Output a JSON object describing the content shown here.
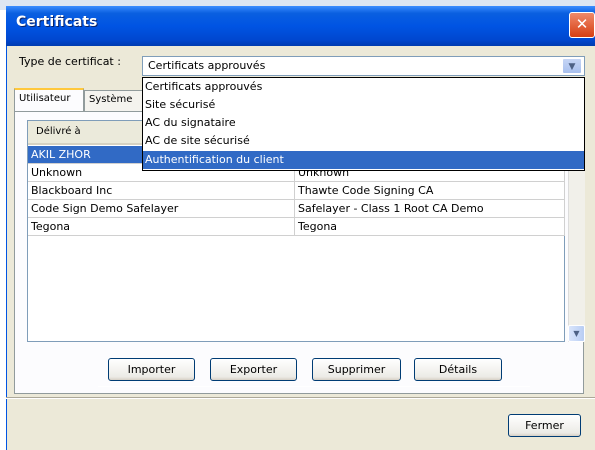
{
  "window": {
    "title": "Certificats",
    "close_glyph": "✕"
  },
  "type_selector": {
    "label": "Type de certificat :",
    "selected": "Certificats approuvés",
    "options": [
      "Certificats approuvés",
      "Site sécurisé",
      "AC du signataire",
      "AC de site sécurisé",
      "Authentification du client"
    ],
    "highlighted_index": 4,
    "arrow_glyph": "▼"
  },
  "tabs": [
    {
      "label": "Utilisateur",
      "active": true
    },
    {
      "label": "Système",
      "active": false
    }
  ],
  "table": {
    "columns": [
      "Délivré à",
      ""
    ],
    "rows": [
      {
        "issued_to": "AKIL ZHOR",
        "issued_by": "",
        "selected": true
      },
      {
        "issued_to": "Unknown",
        "issued_by": "Unknown"
      },
      {
        "issued_to": "Blackboard Inc",
        "issued_by": "Thawte Code Signing CA"
      },
      {
        "issued_to": "Code Sign Demo Safelayer",
        "issued_by": "Safelayer - Class 1 Root CA Demo"
      },
      {
        "issued_to": "Tegona",
        "issued_by": "Tegona"
      }
    ]
  },
  "buttons": {
    "import": "Importer",
    "export": "Exporter",
    "delete": "Supprimer",
    "details": "Détails",
    "close": "Fermer"
  },
  "scroll_glyphs": {
    "up": "▲",
    "down": "▼"
  },
  "colors": {
    "title_bar": "#0054e3",
    "selection": "#316ac5",
    "dialog_bg": "#ece9d8"
  }
}
